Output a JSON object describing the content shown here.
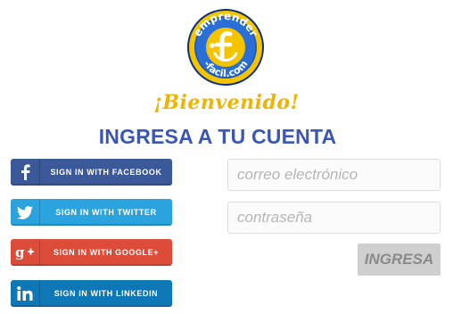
{
  "logo": {
    "brand_top": "emprender",
    "brand_bottom": "-facil.com",
    "colors": {
      "ring": "#f5c400",
      "circle": "#1f5bbf",
      "outline": "#0b2f7a"
    }
  },
  "welcome": "¡Bienvenido!",
  "title": "INGRESA A TU CUENTA",
  "social": {
    "facebook": {
      "label": "SIGN IN WITH FACEBOOK",
      "color": "#3b5998",
      "icon": "facebook-icon"
    },
    "twitter": {
      "label": "SIGN IN WITH TWITTER",
      "color": "#2aa3de",
      "icon": "twitter-icon"
    },
    "google": {
      "label": "SIGN IN WITH GOOGLE+",
      "color": "#dd4b39",
      "icon": "google-plus-icon"
    },
    "linkedin": {
      "label": "SIGN IN WITH LINKEDIN",
      "color": "#0e77b5",
      "icon": "linkedin-icon"
    }
  },
  "form": {
    "email_placeholder": "correo electrónico",
    "email_value": "",
    "password_placeholder": "contraseña",
    "password_value": "",
    "submit_label": "INGRESA"
  },
  "colors": {
    "title": "#3a56b8",
    "welcome": "#f0b400",
    "submit_bg": "#cfcfcf"
  }
}
